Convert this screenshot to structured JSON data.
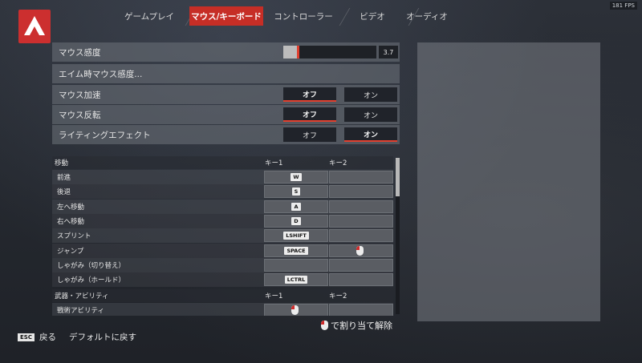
{
  "fps": "181 FPS",
  "tabs": [
    "ゲームプレイ",
    "マウス/キーボード",
    "コントローラー",
    "ビデオ",
    "オーディオ"
  ],
  "active_tab_index": 1,
  "settings": {
    "mouse_sensitivity": {
      "label": "マウス感度",
      "value": "3.7",
      "fill_fraction": 0.15
    },
    "ads_sensitivity": {
      "label": "エイム時マウス感度..."
    },
    "mouse_accel": {
      "label": "マウス加速",
      "off": "オフ",
      "on": "オン",
      "selected": "off"
    },
    "mouse_invert": {
      "label": "マウス反転",
      "off": "オフ",
      "on": "オン",
      "selected": "off"
    },
    "lighting_effect": {
      "label": "ライティングエフェクト",
      "off": "オフ",
      "on": "オン",
      "selected": "on"
    }
  },
  "keybinds": {
    "movement_header": {
      "title": "移動",
      "key1": "キー1",
      "key2": "キー2"
    },
    "movement": [
      {
        "name": "前進",
        "key1": "W",
        "key2": ""
      },
      {
        "name": "後退",
        "key1": "S",
        "key2": ""
      },
      {
        "name": "左へ移動",
        "key1": "A",
        "key2": ""
      },
      {
        "name": "右へ移動",
        "key1": "D",
        "key2": ""
      },
      {
        "name": "スプリント",
        "key1": "LSHIFT",
        "key2": ""
      },
      {
        "name": "ジャンプ",
        "key1": "SPACE",
        "key2": "mouse"
      },
      {
        "name": "しゃがみ（切り替え）",
        "key1": "",
        "key2": ""
      },
      {
        "name": "しゃがみ（ホールド）",
        "key1": "LCTRL",
        "key2": ""
      }
    ],
    "weapons_header": {
      "title": "武器・アビリティ",
      "key1": "キー1",
      "key2": "キー2"
    },
    "weapons": [
      {
        "name": "戦術アビリティ",
        "key1": "mouse",
        "key2": ""
      }
    ]
  },
  "unbind_hint": "で割り当て解除",
  "footer": {
    "esc_key": "ESC",
    "back": "戻る",
    "reset": "デフォルトに戻す"
  },
  "colors": {
    "accent": "#c62e26",
    "highlight": "#e0402f"
  }
}
